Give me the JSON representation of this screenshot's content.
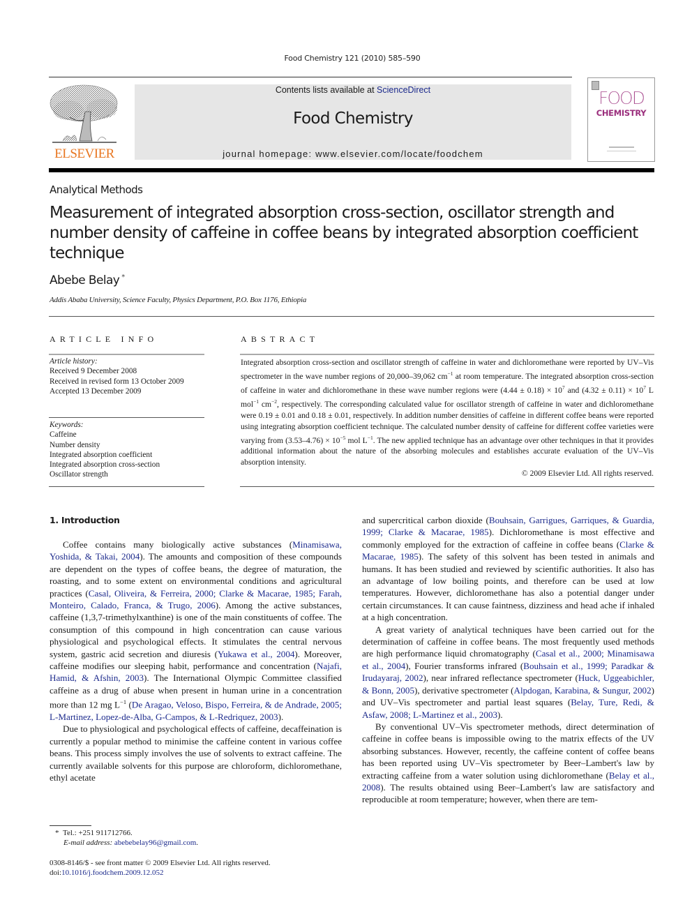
{
  "header": {
    "journal_citation": "Food Chemistry 121 (2010) 585–590",
    "publisher_logo_text": "ELSEVIER",
    "contents_prefix": "Contents lists available at ",
    "contents_link": "ScienceDirect",
    "journal_title": "Food Chemistry",
    "homepage": "journal homepage: www.elsevier.com/locate/foodchem",
    "cover": {
      "line1": "FOOD",
      "line2": "CHEMISTRY",
      "accent_color": "#9b2f7d"
    }
  },
  "article": {
    "section": "Analytical Methods",
    "title": "Measurement of integrated absorption cross-section, oscillator strength and number density of caffeine in coffee beans by integrated absorption coefficient technique",
    "author": "Abebe Belay",
    "author_marker": "*",
    "affiliation": "Addis Ababa University, Science Faculty, Physics Department, P.O. Box 1176, Ethiopia"
  },
  "article_info": {
    "heading": "ARTICLE INFO",
    "history_label": "Article history:",
    "history": [
      "Received 9 December 2008",
      "Received in revised form 13 October 2009",
      "Accepted 13 December 2009"
    ],
    "keywords_label": "Keywords:",
    "keywords": [
      "Caffeine",
      "Number density",
      "Integrated absorption coefficient",
      "Integrated absorption cross-section",
      "Oscillator strength"
    ]
  },
  "abstract": {
    "heading": "ABSTRACT",
    "parts": {
      "a": "Integrated absorption cross-section and oscillator strength of caffeine in water and dichloromethane were reported by UV–Vis spectrometer in the wave number regions of 20,000–39,062 cm",
      "a_sup": "−1",
      "b": " at room temperature. The integrated absorption cross-section of caffeine in water and dichloromethane in these wave number regions were (4.44 ± 0.18) × 10",
      "b_sup": "7",
      "c": " and (4.32 ± 0.11) × 10",
      "c_sup": "7",
      "d": " L mol",
      "d_sup": "−1",
      "e": " cm",
      "e_sup": "−2",
      "f": ", respectively. The corresponding calculated value for oscillator strength of caffeine in water and dichloromethane were 0.19 ± 0.01 and 0.18 ± 0.01, respectively. In addition number densities of caffeine in different coffee beans were reported using integrating absorption coefficient technique. The calculated number density of caffeine for different coffee varieties were varying from (3.53–4.76) × 10",
      "f_sup": "−5",
      "g": " mol L",
      "g_sup": "−1",
      "h": ". The new applied technique has an advantage over other techniques in that it provides additional information about the nature of the absorbing molecules and establishes accurate evaluation of the UV–Vis absorption intensity."
    },
    "copyright": "© 2009 Elsevier Ltd. All rights reserved."
  },
  "body": {
    "intro_heading": "1. Introduction",
    "left": {
      "p1": [
        {
          "t": "Coffee contains many biologically active substances ("
        },
        {
          "t": "Minamisawa, Yoshida, & Takai, 2004",
          "link": true
        },
        {
          "t": "). The amounts and composition of these compounds are dependent on the types of coffee beans, the degree of maturation, the roasting, and to some extent on environmental conditions and agricultural practices ("
        },
        {
          "t": "Casal, Oliveira, & Ferreira, 2000; Clarke & Macarae, 1985; Farah, Monteiro, Calado, Franca, & Trugo, 2006",
          "link": true
        },
        {
          "t": "). Among the active substances, caffeine (1,3,7-trimethylxanthine) is one of the main constituents of coffee. The consumption of this compound in high concentration can cause various physiological and psychological effects. It stimulates the central nervous system, gastric acid secretion and diuresis ("
        },
        {
          "t": "Yukawa et al., 2004",
          "link": true
        },
        {
          "t": "). Moreover, caffeine modifies our sleeping habit, performance and concentration ("
        },
        {
          "t": "Najafi, Hamid, & Afshin, 2003",
          "link": true
        },
        {
          "t": "). The International Olympic Committee classified caffeine as a drug of abuse when present in human urine in a concentration more than 12 mg L"
        },
        {
          "t": "−1",
          "sup": true
        },
        {
          "t": " ("
        },
        {
          "t": "De Aragao, Veloso, Bispo, Ferreira, & de Andrade, 2005; L-Martinez, Lopez-de-Alba, G-Campos, & L-Redriquez, 2003",
          "link": true
        },
        {
          "t": ")."
        }
      ],
      "p2": [
        {
          "t": "Due to physiological and psychological effects of caffeine, decaffeination is currently a popular method to minimise the caffeine content in various coffee beans. This process simply involves the use of solvents to extract caffeine. The currently available solvents for this purpose are chloroform, dichloromethane, ethyl acetate"
        }
      ]
    },
    "right": {
      "p1": [
        {
          "t": "and supercritical carbon dioxide ("
        },
        {
          "t": "Bouhsain, Garrigues, Garriques, & Guardia, 1999; Clarke & Macarae, 1985",
          "link": true
        },
        {
          "t": "). Dichloromethane is most effective and commonly employed for the extraction of caffeine in coffee beans ("
        },
        {
          "t": "Clarke & Macarae, 1985",
          "link": true
        },
        {
          "t": "). The safety of this solvent has been tested in animals and humans. It has been studied and reviewed by scientific authorities. It also has an advantage of low boiling points, and therefore can be used at low temperatures. However, dichloromethane has also a potential danger under certain circumstances. It can cause faintness, dizziness and head ache if inhaled at a high concentration."
        }
      ],
      "p2": [
        {
          "t": "A great variety of analytical techniques have been carried out for the determination of caffeine in coffee beans. The most frequently used methods are high performance liquid chromatography ("
        },
        {
          "t": "Casal et al., 2000; Minamisawa et al., 2004",
          "link": true
        },
        {
          "t": "), Fourier transforms infrared ("
        },
        {
          "t": "Bouhsain et al., 1999; Paradkar & Irudayaraj, 2002",
          "link": true
        },
        {
          "t": "), near infrared reflectance spectrometer ("
        },
        {
          "t": "Huck, Uggeabichler, & Bonn, 2005",
          "link": true
        },
        {
          "t": "), derivative spectrometer ("
        },
        {
          "t": "Alpdogan, Karabina, & Sungur, 2002",
          "link": true
        },
        {
          "t": ") and UV–Vis spectrometer and partial least squares ("
        },
        {
          "t": "Belay, Ture, Redi, & Asfaw, 2008; L-Martinez et al., 2003",
          "link": true
        },
        {
          "t": ")."
        }
      ],
      "p3": [
        {
          "t": "By conventional UV–Vis spectrometer methods, direct determination of caffeine in coffee beans is impossible owing to the matrix effects of the UV absorbing substances. However, recently, the caffeine content of coffee beans has been reported using UV–Vis spectrometer by Beer–Lambert's law by extracting caffeine from a water solution using dichloromethane ("
        },
        {
          "t": "Belay et al., 2008",
          "link": true
        },
        {
          "t": "). The results obtained using Beer–Lambert's law are satisfactory and reproducible at room temperature; however, when there are tem-"
        }
      ]
    }
  },
  "footnotes": {
    "marker": "*",
    "tel": "Tel.: +251 911712766.",
    "email_label": "E-mail address: ",
    "email": "abebebelay96@gmail.com",
    "email_end": ".",
    "issn_line": "0308-8146/$ - see front matter © 2009 Elsevier Ltd. All rights reserved.",
    "doi_label": "doi:",
    "doi": "10.1016/j.foodchem.2009.12.052"
  },
  "colors": {
    "link": "#1c2a8c",
    "elsevier_orange": "#e87722",
    "banner_bg": "#e6e6e6"
  }
}
